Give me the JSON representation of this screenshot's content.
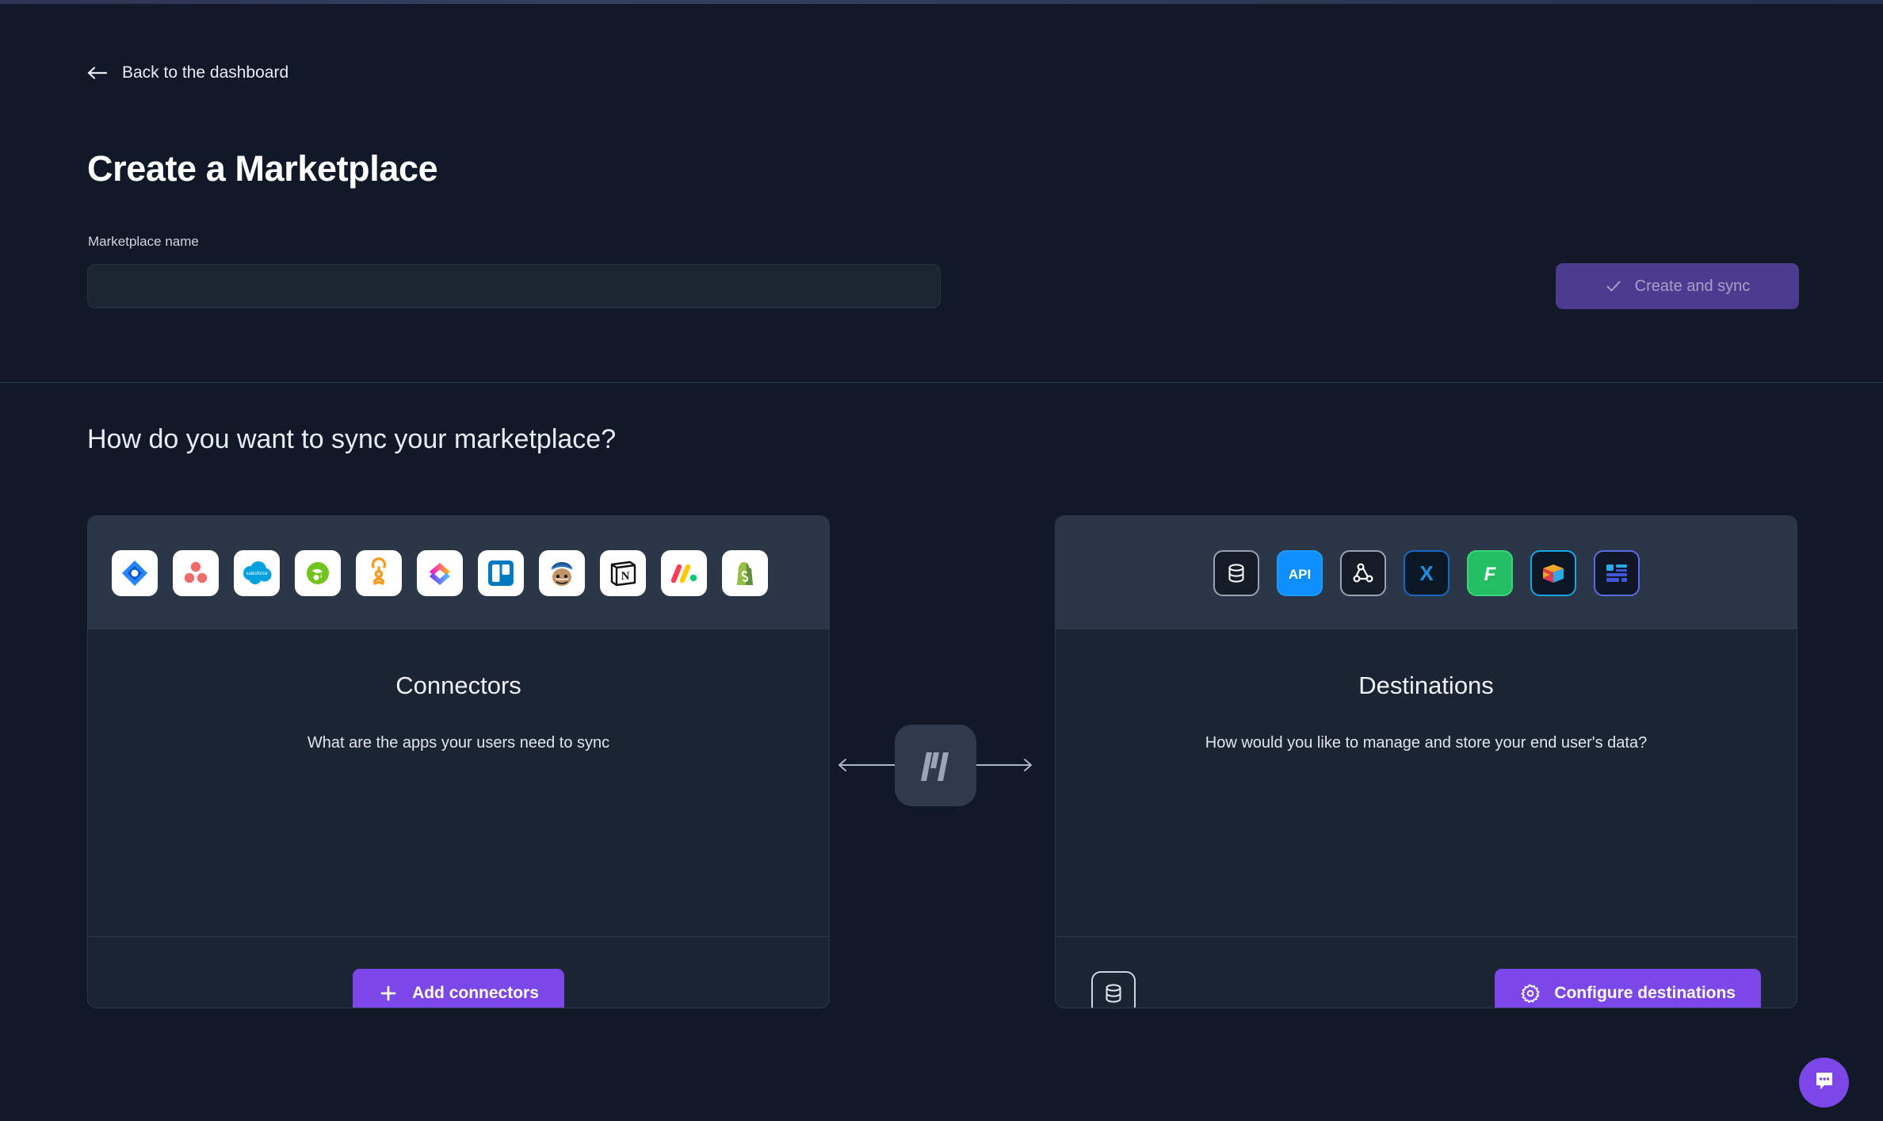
{
  "header": {
    "back_link": "Back to the dashboard",
    "back_icon": "arrow-left-icon",
    "title": "Create a Marketplace",
    "field_label": "Marketplace name",
    "name_value": "",
    "name_placeholder": "",
    "create_button": "Create and sync",
    "create_button_icon": "check-icon",
    "create_button_disabled": true
  },
  "sync": {
    "heading": "How do you want to sync your marketplace?",
    "connectors": {
      "title": "Connectors",
      "subtitle": "What are the apps your users need to sync",
      "button_label": "Add connectors",
      "button_icon": "plus-icon",
      "icons": [
        {
          "name": "jira-icon",
          "label": "Jira"
        },
        {
          "name": "asana-icon",
          "label": "Asana"
        },
        {
          "name": "salesforce-icon",
          "label": "Salesforce"
        },
        {
          "name": "bamboohr-icon",
          "label": "BambooHR"
        },
        {
          "name": "opsgenie-icon",
          "label": "Opsgenie"
        },
        {
          "name": "clickup-icon",
          "label": "ClickUp"
        },
        {
          "name": "trello-icon",
          "label": "Trello"
        },
        {
          "name": "mailchimp-icon",
          "label": "Mailchimp"
        },
        {
          "name": "notion-icon",
          "label": "Notion"
        },
        {
          "name": "monday-icon",
          "label": "Monday.com"
        },
        {
          "name": "shopify-icon",
          "label": "Shopify"
        }
      ]
    },
    "destinations": {
      "title": "Destinations",
      "subtitle": "How would you like to manage and store your end user's data?",
      "button_label": "Configure destinations",
      "button_icon": "gear-icon",
      "footer_icon": "database-icon",
      "icons": [
        {
          "name": "database-icon",
          "label": "Database"
        },
        {
          "name": "api-icon",
          "label": "API"
        },
        {
          "name": "webhook-icon",
          "label": "Webhook"
        },
        {
          "name": "excel-icon",
          "label": "Excel"
        },
        {
          "name": "firebolt-icon",
          "label": "Firebolt"
        },
        {
          "name": "bigquery-icon",
          "label": "BigQuery"
        },
        {
          "name": "datagrid-icon",
          "label": "Data grid"
        }
      ]
    },
    "center_logo": "marketplace-logo-icon",
    "arrow_left": "arrow-left-icon",
    "arrow_right": "arrow-right-icon"
  },
  "chat": {
    "icon": "chat-bubble-icon"
  },
  "colors": {
    "background": "#111827",
    "card_bg": "#1b2432",
    "card_head_bg": "#2b3747",
    "accent_purple": "#7b47e8",
    "disabled_purple": "#4c3c8f",
    "border": "#2b3646",
    "text_primary": "#ffffff",
    "text_secondary": "#dfe5ed"
  }
}
